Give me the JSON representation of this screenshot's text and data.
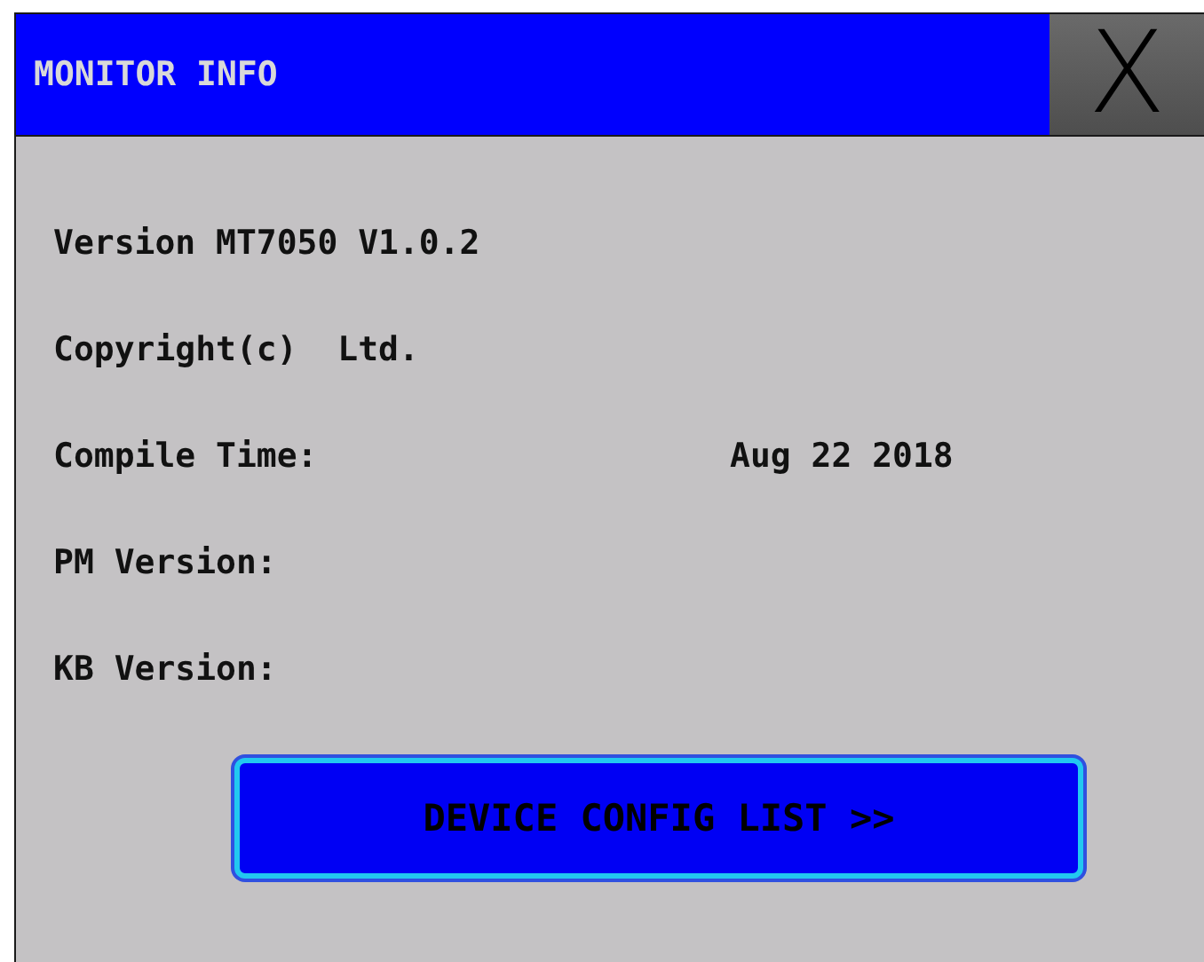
{
  "window": {
    "title": "MONITOR INFO",
    "close_label": "X"
  },
  "rows": [
    {
      "label": "Version MT7050 V1.0.2"
    },
    {
      "label": "Copyright(c)  Ltd."
    },
    {
      "label": "Compile Time:",
      "value": "Aug 22 2018"
    },
    {
      "label": "PM Version:"
    },
    {
      "label": "KB Version:"
    }
  ],
  "button": {
    "label": "DEVICE CONFIG LIST >>"
  }
}
